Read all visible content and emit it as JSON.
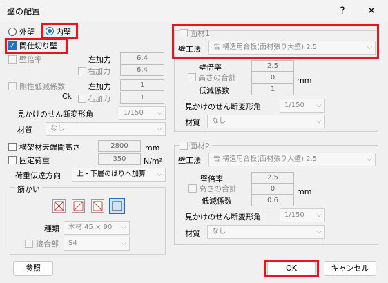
{
  "window": {
    "title": "壁の配置",
    "help": "?",
    "close": "✕"
  },
  "wall_type": {
    "outer": "外壁",
    "inner": "内壁",
    "partition": "間仕切り壁"
  },
  "left": {
    "multiplier_label": "壁倍率",
    "left_force": "左加力",
    "left_force_value": "6.4",
    "right_force": "右加力",
    "right_force_value": "6.4",
    "stiffness_label": "剛性低減係数",
    "ck": "Ck",
    "ck_left_label": "左加力",
    "ck_left_value": "1",
    "ck_right_label": "右加力",
    "ck_right_value": "1",
    "shear_label": "見かけのせん断変形角",
    "shear_value": "1/150",
    "material_label": "材質",
    "material_value": "なし",
    "frame_height_label": "横架材天端間高さ",
    "frame_height_value": "2800",
    "frame_height_unit": "mm",
    "fixed_load_label": "固定荷重",
    "fixed_load_value": "350",
    "fixed_load_unit": "N/m²",
    "load_transfer_label": "荷重伝達方向",
    "load_transfer_value": "上・下層のはりへ加算"
  },
  "brace": {
    "group_label": "筋かい",
    "type_label": "種類",
    "type_value": "木材 45 × 90",
    "joint_label": "接合部",
    "joint_value": "S4"
  },
  "panel1": {
    "label": "面材1",
    "method_label": "壁工法",
    "method_value": "告 構造用合板(面材張り大壁) 2.5",
    "multiplier_label": "壁倍率",
    "multiplier_value": "2.5",
    "height_total_label": "高さの合計",
    "height_total_value": "0",
    "height_unit": "mm",
    "reduction_label": "低減係数",
    "reduction_value": "1",
    "shear_label": "見かけのせん断変形角",
    "shear_value": "1/150",
    "material_label": "材質",
    "material_value": "なし"
  },
  "panel2": {
    "label": "面材2",
    "method_label": "壁工法",
    "method_value": "告 構造用合板(面材張り大壁) 2.5",
    "multiplier_label": "壁倍率",
    "multiplier_value": "2.5",
    "height_total_label": "高さの合計",
    "height_total_value": "0",
    "height_unit": "mm",
    "reduction_label": "低減係数",
    "reduction_value": "0.6",
    "shear_label": "見かけのせん断変形角",
    "shear_value": "1/150",
    "material_label": "材質",
    "material_value": "なし"
  },
  "footer": {
    "browse": "参照",
    "ok": "OK",
    "cancel": "キャンセル"
  },
  "colors": {
    "highlight": "#e8141e",
    "accent": "#1a73c9"
  }
}
